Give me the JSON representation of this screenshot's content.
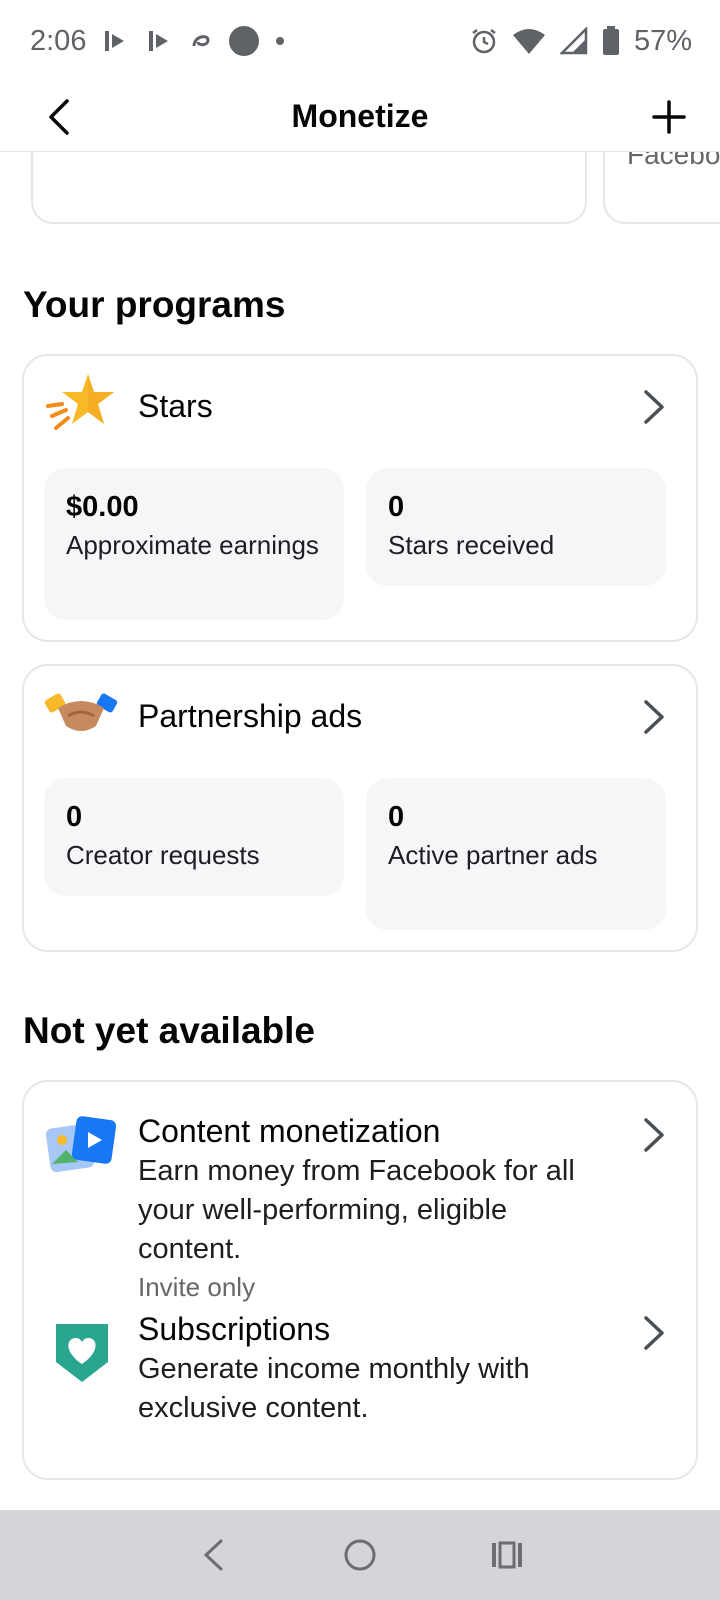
{
  "status_bar": {
    "time": "2:06",
    "battery": "57%"
  },
  "header": {
    "title": "Monetize"
  },
  "carousel": {
    "card2_partial_text": "Facebo"
  },
  "your_programs": {
    "heading": "Your programs",
    "stars": {
      "title": "Stars",
      "stats": [
        {
          "value": "$0.00",
          "label": "Approximate earnings"
        },
        {
          "value": "0",
          "label": "Stars received"
        }
      ]
    },
    "partnership": {
      "title": "Partnership ads",
      "stats": [
        {
          "value": "0",
          "label": "Creator requests"
        },
        {
          "value": "0",
          "label": "Active partner ads"
        }
      ]
    }
  },
  "not_available": {
    "heading": "Not yet available",
    "items": [
      {
        "title": "Content monetization",
        "description": "Earn money from Facebook for all your well-performing, eligible content.",
        "note": "Invite only"
      },
      {
        "title": "Subscriptions",
        "description": "Generate income monthly with exclusive content."
      }
    ]
  },
  "colors": {
    "star": "#f7b928",
    "accent_blue": "#1877f2",
    "subscription_teal": "#2aa58f"
  }
}
